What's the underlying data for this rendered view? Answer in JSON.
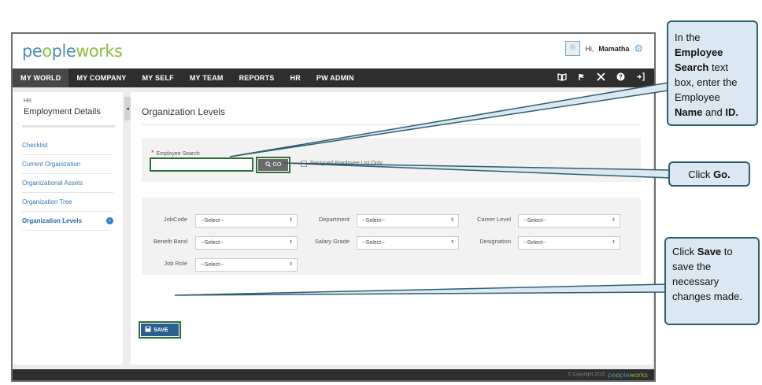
{
  "app": {
    "logo_pre": "pe",
    "logo_o": "o",
    "logo_mid": "ple",
    "logo_w": "w",
    "logo_o2": "o",
    "logo_post": "rks",
    "greeting": "Hi,",
    "user_name": "Mamatha"
  },
  "nav": {
    "items": [
      "MY WORLD",
      "MY COMPANY",
      "MY SELF",
      "MY TEAM",
      "REPORTS",
      "HR",
      "PW ADMIN"
    ],
    "active": "MY WORLD",
    "icons": [
      "book-icon",
      "flag-icon",
      "tools-icon",
      "help-icon",
      "logout-icon"
    ]
  },
  "sidebar": {
    "section": "HR",
    "title": "Employment Details",
    "items": [
      {
        "label": "Checklist"
      },
      {
        "label": "Current Organization"
      },
      {
        "label": "Organizational Assets"
      },
      {
        "label": "Organization Tree"
      },
      {
        "label": "Organization Levels"
      }
    ]
  },
  "main": {
    "title": "Organization Levels",
    "employee_search_label": "Employee Search",
    "required_mark": "*",
    "employee_search_value": "",
    "go_label": "GO",
    "checkbox_label": "Resigned Employee List Only",
    "fields": [
      {
        "label": "JobCode",
        "value": "--Select--"
      },
      {
        "label": "Department",
        "value": "--Select--"
      },
      {
        "label": "Career Level",
        "value": "--Select--"
      },
      {
        "label": "Benefit Band",
        "value": "--Select--"
      },
      {
        "label": "Salary Grade",
        "value": "--Select--"
      },
      {
        "label": "Designation",
        "value": "--Select--"
      },
      {
        "label": "Job Role",
        "value": "--Select--"
      }
    ],
    "save_label": "SAVE"
  },
  "footer": {
    "copyright": "© Copyright 2015"
  },
  "callouts": {
    "c1_a": "In the",
    "c1_b": "Employee Search",
    "c1_c": "text box, enter the Employee",
    "c1_d": "Name",
    "c1_e": "and",
    "c1_f": "ID.",
    "c2_a": "Click",
    "c2_b": "Go.",
    "c3_a": "Click",
    "c3_b": "Save",
    "c3_c": "to save the necessary changes made."
  },
  "colors": {
    "nav_bg": "#2e2e2e",
    "callout_bg": "#dbe8f1",
    "callout_border": "#2f5e6e",
    "highlight_border": "#2e6d3a",
    "save_button": "#2a5f8f",
    "link": "#3a78b0"
  }
}
